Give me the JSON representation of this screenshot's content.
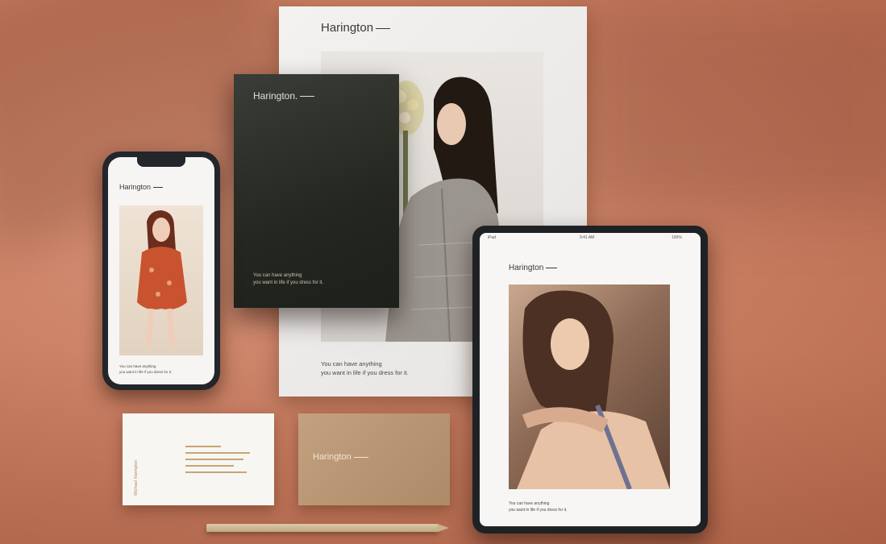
{
  "scene": {
    "background_color": "#c97f63",
    "accent_color": "#b3905d"
  },
  "poster": {
    "brand": "Harington",
    "tagline_line1": "You can have anything",
    "tagline_line2": "you want in life if you dress for it."
  },
  "dark_card": {
    "brand": "Harington.",
    "tagline_line1": "You can have anything",
    "tagline_line2": "you want in life if you dress for it."
  },
  "phone": {
    "brand": "Harington",
    "tagline_line1": "You can have anything",
    "tagline_line2": "you want in life if you dress for it."
  },
  "tablet": {
    "status_left": "iPad",
    "status_center": "9:41 AM",
    "status_right": "100%",
    "brand": "Harington",
    "tagline_line1": "You can have anything",
    "tagline_line2": "you want in life if you dress for it."
  },
  "business_card": {
    "name": "Michael Harington"
  },
  "kraft_card": {
    "brand": "Harington"
  }
}
